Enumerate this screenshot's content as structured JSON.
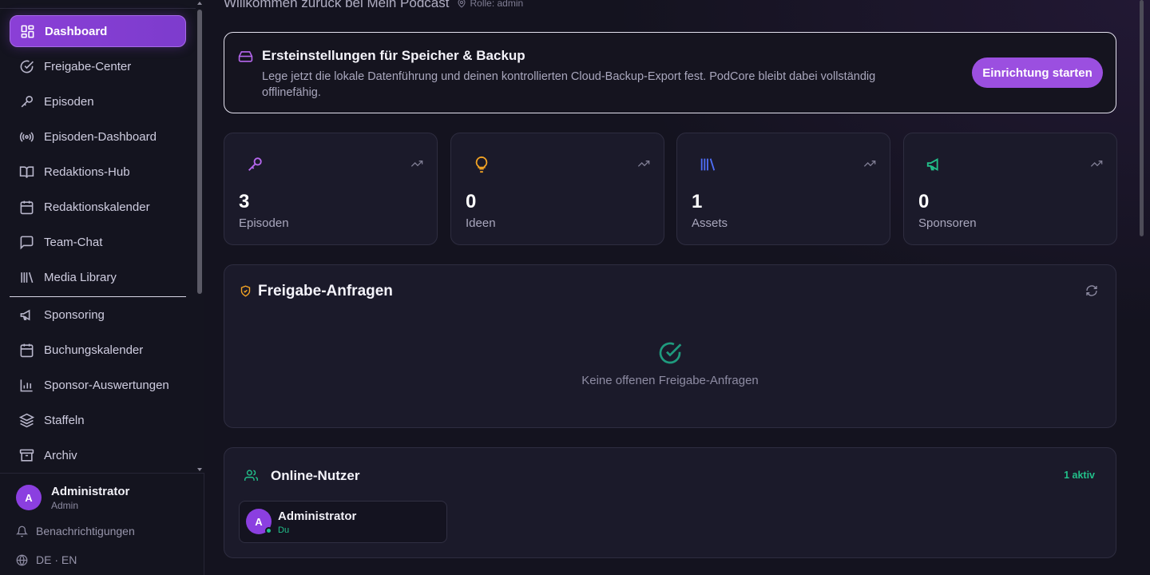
{
  "sidebar": {
    "items": [
      {
        "label": "Dashboard",
        "icon": "dashboard-icon",
        "active": true
      },
      {
        "label": "Freigabe-Center",
        "icon": "check-circle-icon"
      },
      {
        "label": "Episoden",
        "icon": "microphone-icon"
      },
      {
        "label": "Episoden-Dashboard",
        "icon": "broadcast-icon"
      },
      {
        "label": "Redaktions-Hub",
        "icon": "book-icon"
      },
      {
        "label": "Redaktionskalender",
        "icon": "calendar-icon"
      },
      {
        "label": "Team-Chat",
        "icon": "chat-icon"
      },
      {
        "label": "Media Library",
        "icon": "library-icon"
      },
      {
        "label": "Sponsoring",
        "icon": "megaphone-icon"
      },
      {
        "label": "Buchungskalender",
        "icon": "calendar-icon"
      },
      {
        "label": "Sponsor-Auswertungen",
        "icon": "bar-chart-icon"
      },
      {
        "label": "Staffeln",
        "icon": "layers-icon"
      },
      {
        "label": "Archiv",
        "icon": "archive-icon"
      }
    ],
    "user": {
      "initial": "A",
      "name": "Administrator",
      "role": "Admin"
    },
    "notifications_label": "Benachrichtigungen",
    "language_label": "DE · EN"
  },
  "header": {
    "welcome": "Willkommen zurück bei Mein Podcast",
    "role": "Rolle: admin"
  },
  "setup": {
    "title": "Ersteinstellungen für Speicher & Backup",
    "description": "Lege jetzt die lokale Datenführung und deinen kontrollierten Cloud-Backup-Export fest. PodCore bleibt dabei vollständig offlinefähig.",
    "button": "Einrichtung starten"
  },
  "stats": [
    {
      "value": "3",
      "label": "Episoden",
      "icon": "microphone-icon",
      "color": "#b667ef"
    },
    {
      "value": "0",
      "label": "Ideen",
      "icon": "lightbulb-icon",
      "color": "#f5a524"
    },
    {
      "value": "1",
      "label": "Assets",
      "icon": "library-icon",
      "color": "#4f6ef7"
    },
    {
      "value": "0",
      "label": "Sponsoren",
      "icon": "megaphone-icon",
      "color": "#22c08a"
    }
  ],
  "approvals": {
    "title": "Freigabe-Anfragen",
    "empty": "Keine offenen Freigabe-Anfragen"
  },
  "online": {
    "title": "Online-Nutzer",
    "count": "1 aktiv",
    "users": [
      {
        "initial": "A",
        "name": "Administrator",
        "sub": "Du"
      }
    ]
  },
  "colors": {
    "accent": "#9b4fe0",
    "success": "#22c08a",
    "background": "#14131f",
    "card": "#1b1a2a"
  }
}
